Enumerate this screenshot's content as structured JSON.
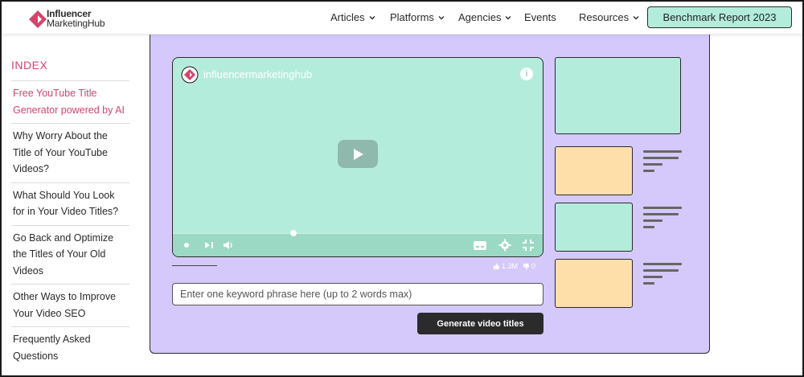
{
  "header": {
    "logo": {
      "line1": "Influencer",
      "line2": "MarketingHub"
    },
    "nav": [
      {
        "label": "Articles",
        "has_dropdown": true
      },
      {
        "label": "Platforms",
        "has_dropdown": true
      },
      {
        "label": "Agencies",
        "has_dropdown": true
      },
      {
        "label": "Events",
        "has_dropdown": false
      },
      {
        "label": "Resources",
        "has_dropdown": true
      }
    ],
    "cta_label": "Benchmark Report 2023"
  },
  "sidebar": {
    "title": "INDEX",
    "items": [
      {
        "label": "Free YouTube Title Generator powered by AI",
        "active": true
      },
      {
        "label": "Why Worry About the Title of Your YouTube Videos?",
        "active": false
      },
      {
        "label": "What Should You Look for in Your Video Titles?",
        "active": false
      },
      {
        "label": "Go Back and Optimize the Titles of Your Old Videos",
        "active": false
      },
      {
        "label": "Other Ways to Improve Your Video SEO",
        "active": false
      },
      {
        "label": "Frequently Asked Questions",
        "active": false
      }
    ]
  },
  "tool": {
    "video": {
      "channel_name": "influencermarketinghub",
      "info_glyph": "i",
      "likes": "1.3M",
      "dislikes": "0",
      "progress": 0.32
    },
    "keyword_input": {
      "value": "",
      "placeholder": "Enter one keyword phrase here (up to 2 words max)"
    },
    "generate_label": "Generate video titles"
  },
  "colors": {
    "accent": "#d3456b",
    "panel_bg": "#d5c9fb",
    "mint": "#b4ecdc",
    "peach": "#fedfa9",
    "cta_bg": "#b4ecdc",
    "button_dark": "#2b2b2b"
  },
  "icons": [
    "logo-mark",
    "chevron-down-icon",
    "play-icon",
    "info-icon",
    "captions-icon",
    "gear-icon",
    "fullscreen-exit-icon",
    "volume-icon",
    "skip-next-icon",
    "thumbs-up-icon",
    "thumbs-down-icon"
  ]
}
